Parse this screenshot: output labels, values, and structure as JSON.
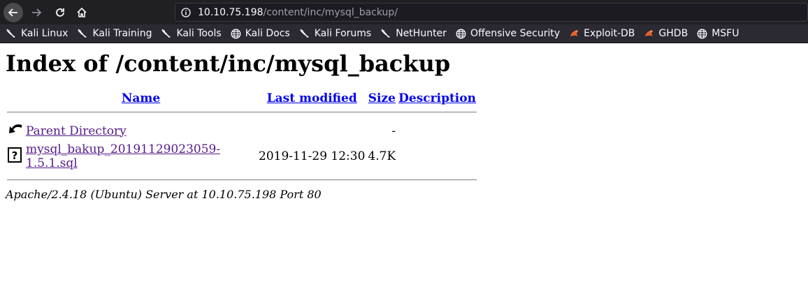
{
  "browser": {
    "url_host": "10.10.75.198",
    "url_path": "/content/inc/mysql_backup/"
  },
  "bookmarks": [
    {
      "label": "Kali Linux",
      "icon": "kali-dragon-icon"
    },
    {
      "label": "Kali Training",
      "icon": "kali-dragon-icon"
    },
    {
      "label": "Kali Tools",
      "icon": "kali-dragon-icon"
    },
    {
      "label": "Kali Docs",
      "icon": "globe-icon"
    },
    {
      "label": "Kali Forums",
      "icon": "kali-dragon-icon"
    },
    {
      "label": "NetHunter",
      "icon": "kali-dragon-icon"
    },
    {
      "label": "Offensive Security",
      "icon": "globe-icon"
    },
    {
      "label": "Exploit-DB",
      "icon": "exploit-db-icon"
    },
    {
      "label": "GHDB",
      "icon": "exploit-db-icon"
    },
    {
      "label": "MSFU",
      "icon": "globe-icon"
    }
  ],
  "page": {
    "title": "Index of /content/inc/mysql_backup",
    "columns": {
      "name": "Name",
      "last_modified": "Last modified",
      "size": "Size",
      "description": "Description"
    },
    "rows": [
      {
        "name": "Parent Directory",
        "modified": "",
        "size": "-",
        "description": "",
        "icon": "back-arrow-icon"
      },
      {
        "name": "mysql_bakup_20191129023059-1.5.1.sql",
        "modified": "2019-11-29 12:30",
        "size": "4.7K",
        "description": "",
        "icon": "unknown-file-icon"
      }
    ],
    "footer": "Apache/2.4.18 (Ubuntu) Server at 10.10.75.198 Port 80"
  }
}
